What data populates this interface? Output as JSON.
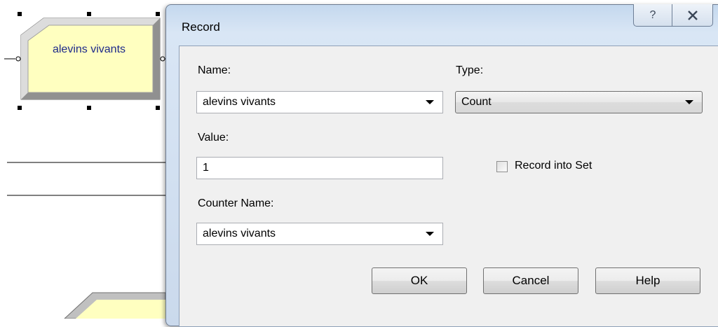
{
  "canvas": {
    "module_label": "alevins vivants"
  },
  "dialog": {
    "title": "Record",
    "help_glyph": "?",
    "close_glyph": "X"
  },
  "form": {
    "name_label": "Name:",
    "name_value": "alevins vivants",
    "type_label": "Type:",
    "type_value": "Count",
    "value_label": "Value:",
    "value_value": "1",
    "record_into_set_label": "Record into Set",
    "record_into_set_checked": false,
    "counter_name_label": "Counter Name:",
    "counter_name_value": "alevins vivants"
  },
  "buttons": {
    "ok": "OK",
    "cancel": "Cancel",
    "help": "Help"
  },
  "colors": {
    "module_fill": "#ffffc0",
    "module_text": "#1e2a8a",
    "titlebar": "#cddcef"
  }
}
